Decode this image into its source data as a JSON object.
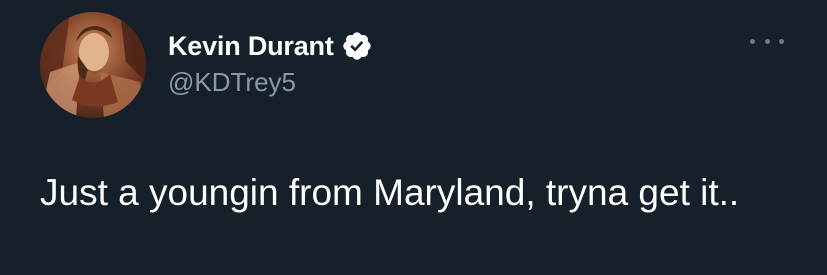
{
  "tweet": {
    "author": {
      "display_name": "Kevin Durant",
      "handle": "@KDTrey5",
      "verified": true,
      "avatar_icon": "profile-avatar"
    },
    "text": "Just a youngin from Maryland, tryna get it..",
    "more_icon": "more-options-icon"
  },
  "colors": {
    "background": "#15202b",
    "text_primary": "#ffffff",
    "text_secondary": "#8b98a5",
    "verified_badge": "#ffffff"
  }
}
